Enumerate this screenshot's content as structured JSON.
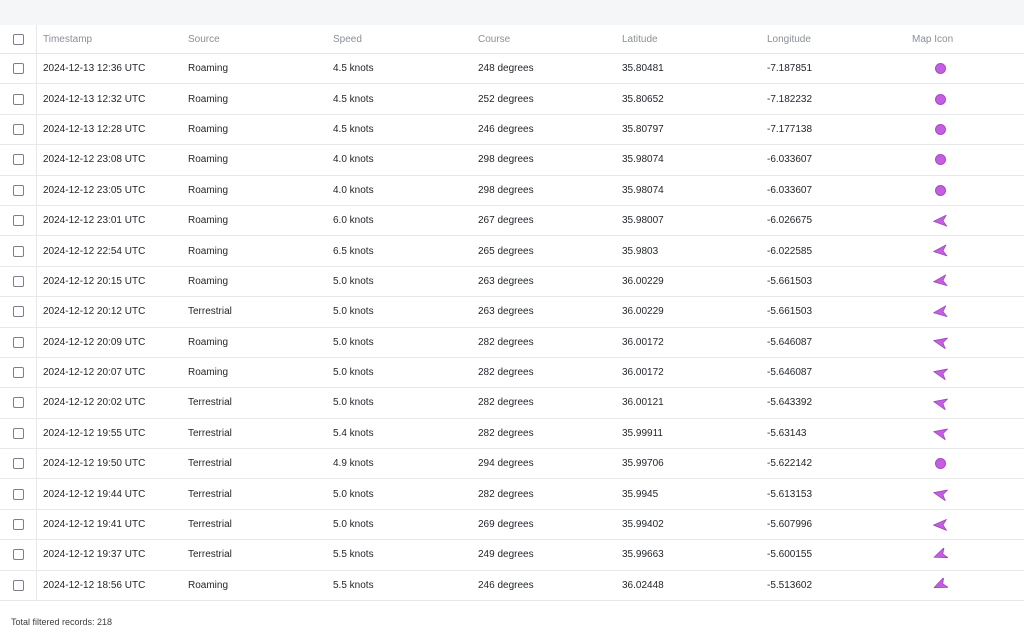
{
  "columns": {
    "timestamp": "Timestamp",
    "source": "Source",
    "speed": "Speed",
    "course": "Course",
    "latitude": "Latitude",
    "longitude": "Longitude",
    "map_icon": "Map Icon"
  },
  "colors": {
    "marker": "#c35fe0"
  },
  "rows": [
    {
      "timestamp": "2024-12-13 12:36 UTC",
      "source": "Roaming",
      "speed": "4.5 knots",
      "course": "248 degrees",
      "latitude": "35.80481",
      "longitude": "-7.187851",
      "icon": "dot"
    },
    {
      "timestamp": "2024-12-13 12:32 UTC",
      "source": "Roaming",
      "speed": "4.5 knots",
      "course": "252 degrees",
      "latitude": "35.80652",
      "longitude": "-7.182232",
      "icon": "dot"
    },
    {
      "timestamp": "2024-12-13 12:28 UTC",
      "source": "Roaming",
      "speed": "4.5 knots",
      "course": "246 degrees",
      "latitude": "35.80797",
      "longitude": "-7.177138",
      "icon": "dot"
    },
    {
      "timestamp": "2024-12-12 23:08 UTC",
      "source": "Roaming",
      "speed": "4.0 knots",
      "course": "298 degrees",
      "latitude": "35.98074",
      "longitude": "-6.033607",
      "icon": "dot"
    },
    {
      "timestamp": "2024-12-12 23:05 UTC",
      "source": "Roaming",
      "speed": "4.0 knots",
      "course": "298 degrees",
      "latitude": "35.98074",
      "longitude": "-6.033607",
      "icon": "dot"
    },
    {
      "timestamp": "2024-12-12 23:01 UTC",
      "source": "Roaming",
      "speed": "6.0 knots",
      "course": "267 degrees",
      "latitude": "35.98007",
      "longitude": "-6.026675",
      "icon": "arrow"
    },
    {
      "timestamp": "2024-12-12 22:54 UTC",
      "source": "Roaming",
      "speed": "6.5 knots",
      "course": "265 degrees",
      "latitude": "35.9803",
      "longitude": "-6.022585",
      "icon": "arrow"
    },
    {
      "timestamp": "2024-12-12 20:15 UTC",
      "source": "Roaming",
      "speed": "5.0 knots",
      "course": "263 degrees",
      "latitude": "36.00229",
      "longitude": "-5.661503",
      "icon": "arrow"
    },
    {
      "timestamp": "2024-12-12 20:12 UTC",
      "source": "Terrestrial",
      "speed": "5.0 knots",
      "course": "263 degrees",
      "latitude": "36.00229",
      "longitude": "-5.661503",
      "icon": "arrow"
    },
    {
      "timestamp": "2024-12-12 20:09 UTC",
      "source": "Roaming",
      "speed": "5.0 knots",
      "course": "282 degrees",
      "latitude": "36.00172",
      "longitude": "-5.646087",
      "icon": "arrow"
    },
    {
      "timestamp": "2024-12-12 20:07 UTC",
      "source": "Roaming",
      "speed": "5.0 knots",
      "course": "282 degrees",
      "latitude": "36.00172",
      "longitude": "-5.646087",
      "icon": "arrow"
    },
    {
      "timestamp": "2024-12-12 20:02 UTC",
      "source": "Terrestrial",
      "speed": "5.0 knots",
      "course": "282 degrees",
      "latitude": "36.00121",
      "longitude": "-5.643392",
      "icon": "arrow"
    },
    {
      "timestamp": "2024-12-12 19:55 UTC",
      "source": "Terrestrial",
      "speed": "5.4 knots",
      "course": "282 degrees",
      "latitude": "35.99911",
      "longitude": "-5.63143",
      "icon": "arrow"
    },
    {
      "timestamp": "2024-12-12 19:50 UTC",
      "source": "Terrestrial",
      "speed": "4.9 knots",
      "course": "294 degrees",
      "latitude": "35.99706",
      "longitude": "-5.622142",
      "icon": "dot"
    },
    {
      "timestamp": "2024-12-12 19:44 UTC",
      "source": "Terrestrial",
      "speed": "5.0 knots",
      "course": "282 degrees",
      "latitude": "35.9945",
      "longitude": "-5.613153",
      "icon": "arrow"
    },
    {
      "timestamp": "2024-12-12 19:41 UTC",
      "source": "Terrestrial",
      "speed": "5.0 knots",
      "course": "269 degrees",
      "latitude": "35.99402",
      "longitude": "-5.607996",
      "icon": "arrow"
    },
    {
      "timestamp": "2024-12-12 19:37 UTC",
      "source": "Terrestrial",
      "speed": "5.5 knots",
      "course": "249 degrees",
      "latitude": "35.99663",
      "longitude": "-5.600155",
      "icon": "arrow"
    },
    {
      "timestamp": "2024-12-12 18:56 UTC",
      "source": "Roaming",
      "speed": "5.5 knots",
      "course": "246 degrees",
      "latitude": "36.02448",
      "longitude": "-5.513602",
      "icon": "arrow"
    }
  ],
  "footer": {
    "total_text": "Total filtered records: 218"
  }
}
